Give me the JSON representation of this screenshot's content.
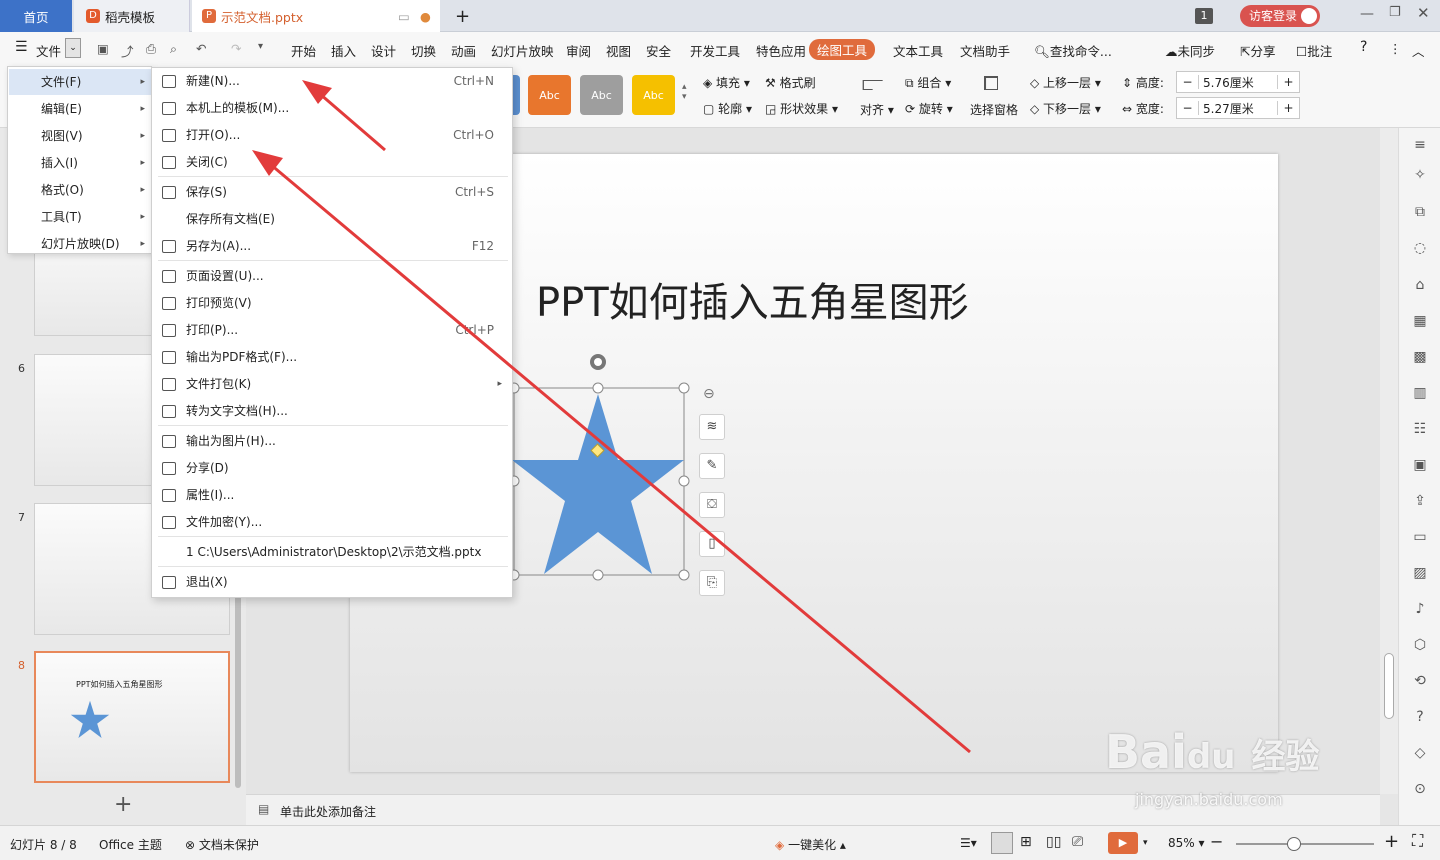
{
  "tabs": {
    "home": "首页",
    "template": "稻壳模板",
    "doc": "示范文档.pptx",
    "add": "+",
    "badge": "1",
    "login": "访客登录"
  },
  "toolbar": {
    "file": "文件",
    "items": [
      "开始",
      "插入",
      "设计",
      "切换",
      "动画",
      "幻灯片放映",
      "审阅",
      "视图",
      "安全",
      "开发工具",
      "特色应用",
      "绘图工具",
      "文本工具",
      "文档助手"
    ],
    "active": "绘图工具",
    "search": "查找命令...",
    "sync": "未同步",
    "share": "分享",
    "comment": "批注"
  },
  "ribbon": {
    "style": "Abc",
    "fill": "填充",
    "format_brush": "格式刷",
    "outline": "轮廓",
    "shape_effect": "形状效果",
    "align": "对齐",
    "group": "组合",
    "rotate": "旋转",
    "select_pane": "选择窗格",
    "bring_forward": "上移一层",
    "send_backward": "下移一层",
    "height_label": "高度:",
    "height": "5.76厘米",
    "width_label": "宽度:",
    "width": "5.27厘米",
    "minus": "−",
    "plus": "+"
  },
  "menu1": [
    {
      "label": "文件(F)"
    },
    {
      "label": "编辑(E)"
    },
    {
      "label": "视图(V)"
    },
    {
      "label": "插入(I)"
    },
    {
      "label": "格式(O)"
    },
    {
      "label": "工具(T)"
    },
    {
      "label": "幻灯片放映(D)"
    }
  ],
  "menu2": [
    {
      "label": "新建(N)...",
      "shortcut": "Ctrl+N"
    },
    {
      "label": "本机上的模板(M)...",
      "shortcut": ""
    },
    {
      "label": "打开(O)...",
      "shortcut": "Ctrl+O"
    },
    {
      "label": "关闭(C)",
      "shortcut": ""
    },
    {
      "label": "保存(S)",
      "shortcut": "Ctrl+S"
    },
    {
      "label": "保存所有文档(E)",
      "shortcut": ""
    },
    {
      "label": "另存为(A)...",
      "shortcut": "F12"
    },
    {
      "label": "页面设置(U)...",
      "shortcut": ""
    },
    {
      "label": "打印预览(V)",
      "shortcut": ""
    },
    {
      "label": "打印(P)...",
      "shortcut": "Ctrl+P"
    },
    {
      "label": "输出为PDF格式(F)...",
      "shortcut": ""
    },
    {
      "label": "文件打包(K)",
      "shortcut": ""
    },
    {
      "label": "转为文字文档(H)...",
      "shortcut": ""
    },
    {
      "label": "输出为图片(H)...",
      "shortcut": ""
    },
    {
      "label": "分享(D)",
      "shortcut": ""
    },
    {
      "label": "属性(I)...",
      "shortcut": ""
    },
    {
      "label": "文件加密(Y)...",
      "shortcut": ""
    },
    {
      "label": "1 C:\\Users\\Administrator\\Desktop\\2\\示范文档.pptx",
      "shortcut": ""
    },
    {
      "label": "退出(X)",
      "shortcut": ""
    }
  ],
  "slides": {
    "nums": [
      "6",
      "7",
      "8"
    ],
    "thumb_title": "PPT如何插入五角星图形",
    "add": "+"
  },
  "slide": {
    "title": "PPT如何插入五角星图形"
  },
  "notes": "单击此处添加备注",
  "status": {
    "slide": "幻灯片 8 / 8",
    "theme": "Office 主题",
    "protect": "文档未保护",
    "beautify": "一键美化",
    "zoom": "85%"
  },
  "watermark": {
    "brand": "Bai",
    "cn": "经验",
    "url": "jingyan.baidu.com"
  },
  "colors": {
    "accent": "#e06b3c",
    "blue": "#5b8fd0",
    "star": "#5b95d5",
    "arrow": "#e23b3b"
  }
}
